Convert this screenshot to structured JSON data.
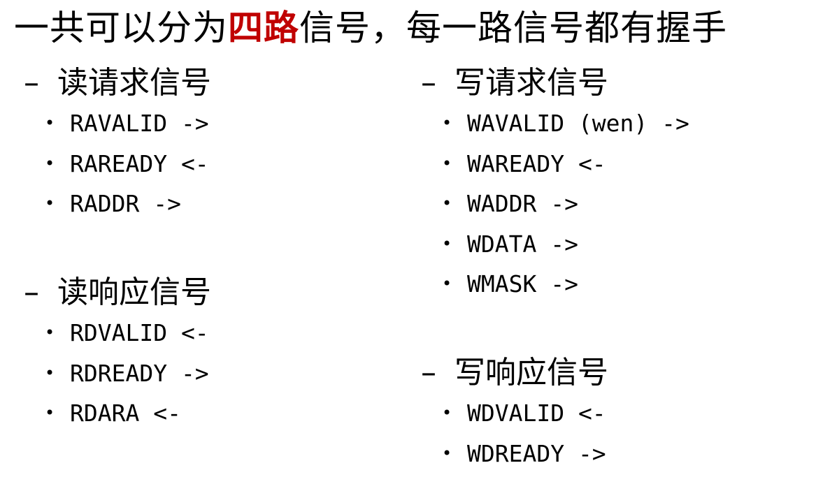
{
  "headline": {
    "prefix": "一共可以分为",
    "highlight": "四路",
    "suffix": "信号，每一路信号都有握手"
  },
  "sections": {
    "read_request": {
      "dash": "–",
      "title": "读请求信号",
      "items": [
        "RAVALID ->",
        "RAREADY <-",
        "RADDR ->"
      ]
    },
    "read_response": {
      "dash": "–",
      "title": "读响应信号",
      "items": [
        "RDVALID <-",
        "RDREADY ->",
        "RDARA <-"
      ]
    },
    "write_request": {
      "dash": "–",
      "title": "写请求信号",
      "items": [
        "WAVALID (wen) ->",
        "WAREADY <-",
        "WADDR ->",
        "WDATA ->",
        "WMASK ->"
      ]
    },
    "write_response": {
      "dash": "–",
      "title": "写响应信号",
      "items": [
        "WDVALID <-",
        "WDREADY ->"
      ]
    }
  },
  "bullet": "•",
  "colors": {
    "highlight": "#c00000",
    "text": "#000000",
    "background": "#ffffff"
  }
}
